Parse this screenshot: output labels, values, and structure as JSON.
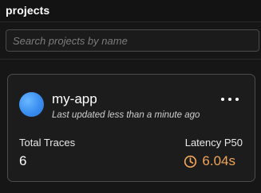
{
  "header": {
    "title": "projects"
  },
  "search": {
    "placeholder": "Search projects by name"
  },
  "project_card": {
    "name": "my-app",
    "updated": "Last updated less than a minute ago",
    "metrics": {
      "traces_label": "Total Traces",
      "traces_value": "6",
      "latency_label": "Latency P50",
      "latency_value": "6.04s"
    },
    "avatar_color": "#3a8ef0",
    "latency_color": "#f0a55a"
  }
}
